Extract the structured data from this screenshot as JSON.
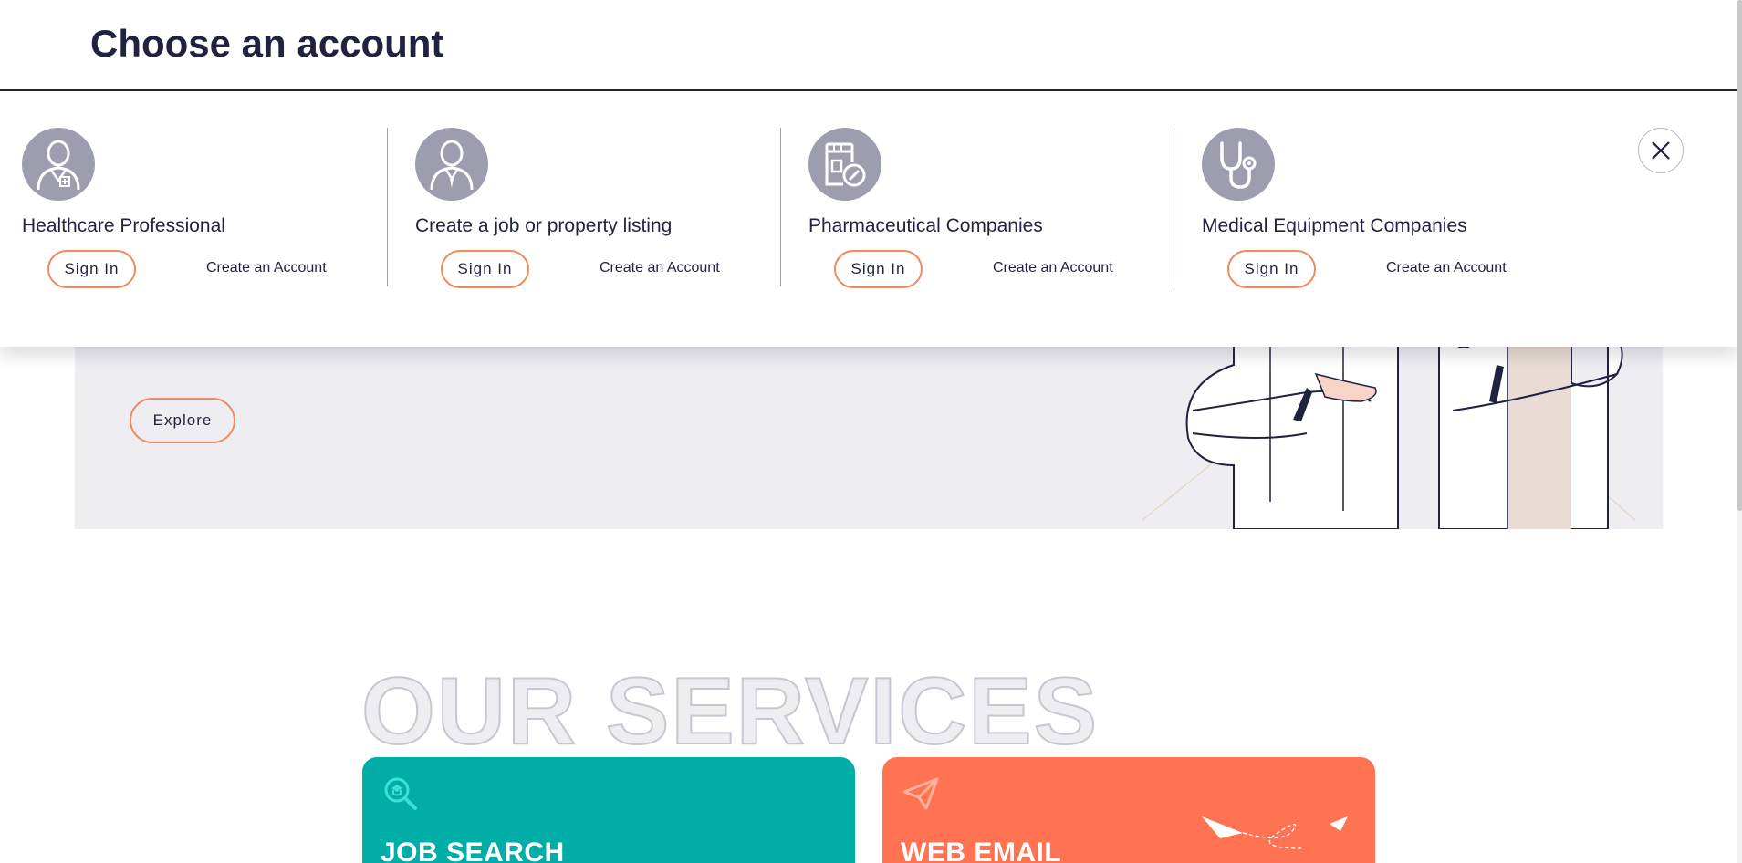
{
  "modal": {
    "title": "Choose an account",
    "accounts": [
      {
        "label": "Healthcare Professional",
        "icon": "doctor-avatar-icon",
        "signin_label": "Sign In",
        "create_label": "Create an Account"
      },
      {
        "label": "Create a job or property listing",
        "icon": "person-avatar-icon",
        "signin_label": "Sign In",
        "create_label": "Create an Account"
      },
      {
        "label": "Pharmaceutical Companies",
        "icon": "medicine-bottle-icon",
        "signin_label": "Sign In",
        "create_label": "Create an Account"
      },
      {
        "label": "Medical Equipment Companies",
        "icon": "stethoscope-icon",
        "signin_label": "Sign In",
        "create_label": "Create an Account"
      }
    ],
    "close_icon": "close-icon"
  },
  "hero": {
    "explore_label": "Explore"
  },
  "services": {
    "heading": "OUR SERVICES",
    "cards": [
      {
        "title": "JOB SEARCH",
        "icon": "search-icon",
        "color": "#00aea7"
      },
      {
        "title": "WEB EMAIL",
        "icon": "paper-plane-icon",
        "color": "#ff7352"
      }
    ]
  },
  "colors": {
    "accent": "#f08a5d",
    "text": "#1f2340",
    "icon_bg": "#9c9eb0",
    "hero_bg": "#eeeef2"
  }
}
